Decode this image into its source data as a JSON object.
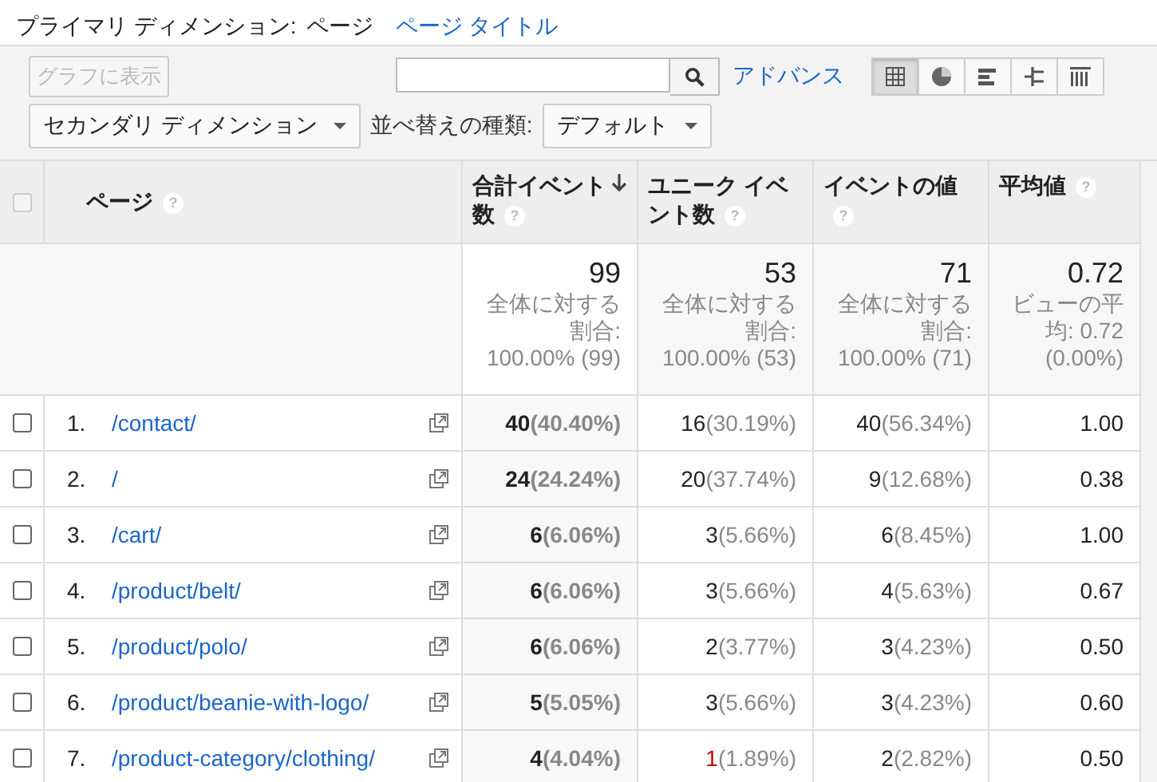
{
  "primary_dimension": {
    "label": "プライマリ ディメンション:",
    "options": [
      {
        "label": "ページ",
        "selected": true
      },
      {
        "label": "ページ タイトル",
        "selected": false
      }
    ]
  },
  "toolbar": {
    "chart_button": {
      "label": "グラフに表示",
      "disabled": true
    },
    "search": {
      "placeholder_shown": true
    },
    "advanced_link": "アドバンス",
    "views": [
      {
        "kind": "table",
        "selected": true
      },
      {
        "kind": "pie",
        "selected": false
      },
      {
        "kind": "bars",
        "selected": false
      },
      {
        "kind": "compare",
        "selected": false
      },
      {
        "kind": "pivot",
        "selected": false
      }
    ],
    "secondary_dimension": "セカンダリ ディメンション",
    "sort_label": "並べ替えの種類:",
    "sort_value": "デフォルト"
  },
  "table": {
    "select_all_checked": false,
    "columns": [
      {
        "label": "ページ",
        "help": "?",
        "sorted": false
      },
      {
        "label": "合計イベント数",
        "help": "?",
        "sorted": true
      },
      {
        "label": "ユニーク イベント数",
        "help": "?",
        "sorted": false
      },
      {
        "label": "イベントの値",
        "help": "?",
        "sorted": false
      },
      {
        "label": "平均値",
        "help": "?",
        "sorted": false
      }
    ],
    "totals": [
      {
        "value": "99",
        "note": "全体に対する割合: 100.00% (99)"
      },
      {
        "value": "53",
        "note": "全体に対する割合: 100.00% (53)"
      },
      {
        "value": "71",
        "note": "全体に対する割合: 100.00% (71)"
      },
      {
        "value": "0.72",
        "note": "ビューの平均: 0.72 (0.00%)"
      }
    ],
    "rows": [
      {
        "checked": false,
        "rank": "1.",
        "page": "/contact/",
        "total": {
          "value": "40",
          "share": "(40.40%)"
        },
        "unique": {
          "value": "16",
          "share": "(30.19%)",
          "alert": false
        },
        "event_value": {
          "value": "40",
          "share": "(56.34%)"
        },
        "average": "1.00"
      },
      {
        "checked": false,
        "rank": "2.",
        "page": "/",
        "total": {
          "value": "24",
          "share": "(24.24%)"
        },
        "unique": {
          "value": "20",
          "share": "(37.74%)",
          "alert": false
        },
        "event_value": {
          "value": "9",
          "share": "(12.68%)"
        },
        "average": "0.38"
      },
      {
        "checked": false,
        "rank": "3.",
        "page": "/cart/",
        "total": {
          "value": "6",
          "share": "(6.06%)"
        },
        "unique": {
          "value": "3",
          "share": "(5.66%)",
          "alert": false
        },
        "event_value": {
          "value": "6",
          "share": "(8.45%)"
        },
        "average": "1.00"
      },
      {
        "checked": false,
        "rank": "4.",
        "page": "/product/belt/",
        "total": {
          "value": "6",
          "share": "(6.06%)"
        },
        "unique": {
          "value": "3",
          "share": "(5.66%)",
          "alert": false
        },
        "event_value": {
          "value": "4",
          "share": "(5.63%)"
        },
        "average": "0.67"
      },
      {
        "checked": false,
        "rank": "5.",
        "page": "/product/polo/",
        "total": {
          "value": "6",
          "share": "(6.06%)"
        },
        "unique": {
          "value": "2",
          "share": "(3.77%)",
          "alert": false
        },
        "event_value": {
          "value": "3",
          "share": "(4.23%)"
        },
        "average": "0.50"
      },
      {
        "checked": false,
        "rank": "6.",
        "page": "/product/beanie-with-logo/",
        "total": {
          "value": "5",
          "share": "(5.05%)"
        },
        "unique": {
          "value": "3",
          "share": "(5.66%)",
          "alert": false
        },
        "event_value": {
          "value": "3",
          "share": "(4.23%)"
        },
        "average": "0.60"
      },
      {
        "checked": false,
        "rank": "7.",
        "page": "/product-category/clothing/",
        "total": {
          "value": "4",
          "share": "(4.04%)"
        },
        "unique": {
          "value": "1",
          "share": "(1.89%)",
          "alert": true
        },
        "event_value": {
          "value": "2",
          "share": "(2.82%)"
        },
        "average": "0.50"
      }
    ]
  }
}
